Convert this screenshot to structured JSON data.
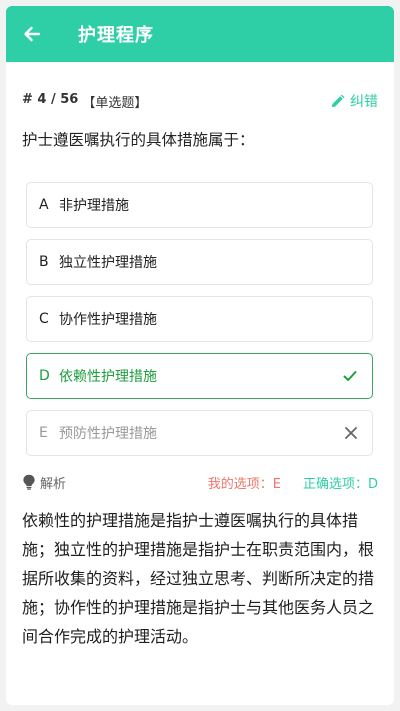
{
  "header": {
    "title": "护理程序",
    "back_icon": "arrow-left-icon"
  },
  "meta": {
    "index": "# 4 / 56",
    "type": "【单选题】",
    "report_label": "纠错"
  },
  "question": {
    "text": "护士遵医嘱执行的具体措施属于："
  },
  "options": [
    {
      "letter": "A",
      "text": "非护理措施",
      "state": "normal"
    },
    {
      "letter": "B",
      "text": "独立性护理措施",
      "state": "normal"
    },
    {
      "letter": "C",
      "text": "协作性护理措施",
      "state": "normal"
    },
    {
      "letter": "D",
      "text": "依赖性护理措施",
      "state": "correct"
    },
    {
      "letter": "E",
      "text": "预防性护理措施",
      "state": "wrong"
    }
  ],
  "analysis": {
    "label": "解析",
    "my_answer_label": "我的选项：E",
    "correct_answer_label": "正确选项：D",
    "text": "依赖性的护理措施是指护士遵医嘱执行的具体措施；独立性的护理措施是指护士在职责范围内，根据所收集的资料，经过独立思考、判断所决定的措施；协作性的护理措施是指护士与其他医务人员之间合作完成的护理活动。"
  },
  "colors": {
    "accent": "#2ecfa7",
    "correct": "#1f9e3d",
    "wrong_answer": "#f0766a"
  }
}
